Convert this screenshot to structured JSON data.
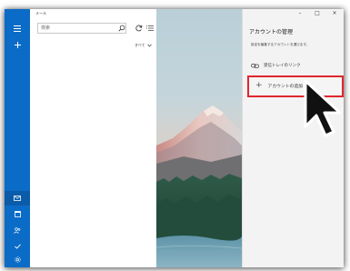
{
  "app": {
    "title": "メール"
  },
  "search": {
    "placeholder": "検索"
  },
  "filter": {
    "label": "すべて"
  },
  "window_controls": {
    "minimize": "–",
    "maximize": "□",
    "close": "×"
  },
  "rail": {
    "top_icons": [
      "hamburger-icon",
      "plus-icon"
    ],
    "bottom_icons": [
      "mail-icon",
      "calendar-icon",
      "people-icon",
      "todo-icon",
      "settings-icon"
    ]
  },
  "account_panel": {
    "title": "アカウントの管理",
    "subtitle": "設定を編集するアカウントを選びます。",
    "linked_inbox": "受信トレイのリンク",
    "add_account": "アカウントの追加"
  },
  "colors": {
    "accent": "#0b6cc7",
    "highlight": "#e0262d",
    "panel_bg": "#f3f3f3"
  }
}
